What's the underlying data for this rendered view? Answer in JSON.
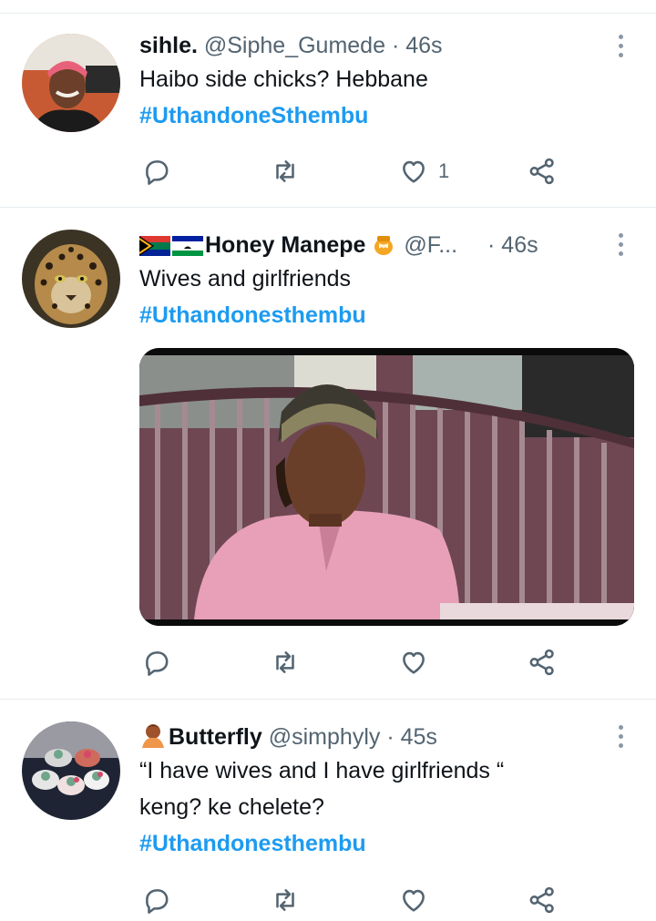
{
  "tweets": [
    {
      "display_name": "sihle.",
      "handle": "@Siphe_Gumede",
      "separator": "·",
      "time": "46s",
      "text": "Haibo side chicks? Hebbane",
      "hashtag": "#UthandoneSthembu",
      "actions": {
        "reply": "",
        "retweet": "",
        "like": "1",
        "share": ""
      }
    },
    {
      "display_name": "Honey Manepe",
      "handle": "@F...",
      "separator": "·",
      "time": "46s",
      "text": "Wives and girlfriends",
      "hashtag": "#Uthandonesthembu",
      "actions": {
        "reply": "",
        "retweet": "",
        "like": "",
        "share": ""
      }
    },
    {
      "display_name": "Butterfly",
      "handle": "@simphyly",
      "separator": "·",
      "time": "45s",
      "text_lines": [
        "“I have wives and I have girlfriends “",
        "keng? ke chelete?"
      ],
      "hashtag": "#Uthandonesthembu",
      "actions": {
        "reply": "",
        "retweet": "",
        "like": "",
        "share": ""
      }
    }
  ],
  "icons": {
    "reply": "speech-bubble-icon",
    "retweet": "retweet-arrows-icon",
    "like": "heart-outline-icon",
    "share": "share-nodes-icon",
    "more": "vertical-ellipsis-icon"
  },
  "colors": {
    "link": "#1d9bf0",
    "muted": "#536471",
    "divider": "#e6ecf0"
  }
}
